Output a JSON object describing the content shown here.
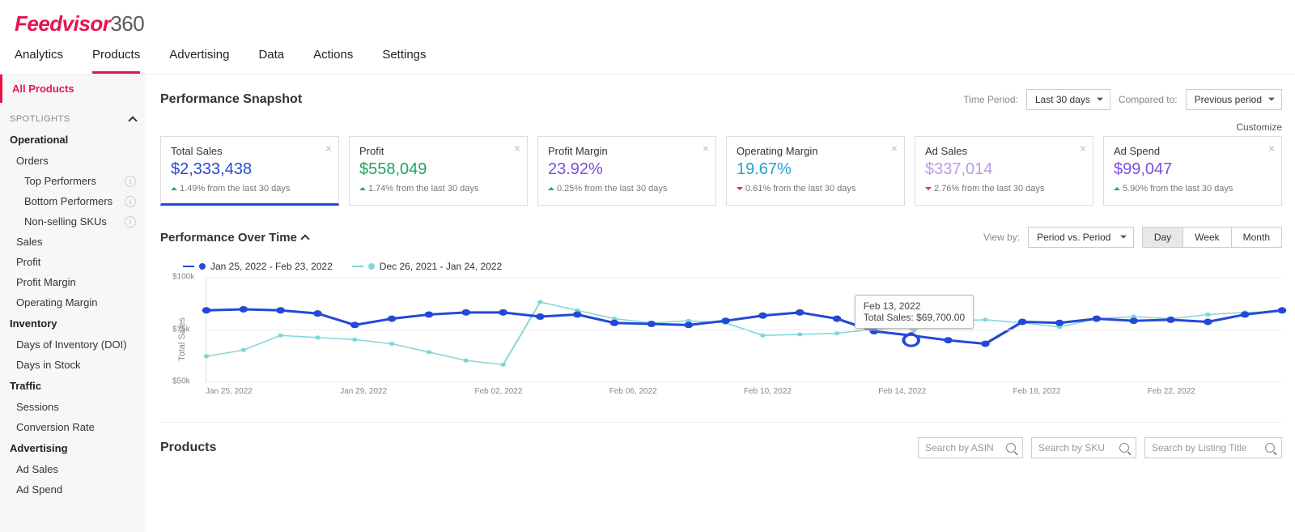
{
  "brand": {
    "name1": "Feedvisor",
    "name2": "360"
  },
  "nav": [
    "Analytics",
    "Products",
    "Advertising",
    "Data",
    "Actions",
    "Settings"
  ],
  "nav_active": 1,
  "sidebar": {
    "all_products": "All Products",
    "spotlights": "SPOTLIGHTS",
    "groups": [
      {
        "title": "Operational",
        "items": [
          {
            "label": "Orders"
          },
          {
            "label": "Top Performers",
            "info": true,
            "sub": true
          },
          {
            "label": "Bottom Performers",
            "info": true,
            "sub": true
          },
          {
            "label": "Non-selling SKUs",
            "info": true,
            "sub": true
          }
        ]
      },
      {
        "title": "",
        "items": [
          {
            "label": "Sales"
          },
          {
            "label": "Profit"
          },
          {
            "label": "Profit Margin"
          },
          {
            "label": "Operating Margin"
          }
        ]
      },
      {
        "title": "Inventory",
        "items": [
          {
            "label": "Days of Inventory (DOI)"
          },
          {
            "label": "Days in Stock"
          }
        ]
      },
      {
        "title": "Traffic",
        "items": [
          {
            "label": "Sessions"
          },
          {
            "label": "Conversion Rate"
          }
        ]
      },
      {
        "title": "Advertising",
        "items": [
          {
            "label": "Ad Sales"
          },
          {
            "label": "Ad Spend"
          }
        ]
      }
    ]
  },
  "snapshot": {
    "title": "Performance Snapshot",
    "time_period_label": "Time Period:",
    "time_period_value": "Last 30 days",
    "compared_label": "Compared to:",
    "compared_value": "Previous period",
    "customize": "Customize"
  },
  "cards": [
    {
      "title": "Total Sales",
      "value": "$2,333,438",
      "color": "#2449d6",
      "dir": "up",
      "delta": "1.49% from the last 30 days",
      "selected": true
    },
    {
      "title": "Profit",
      "value": "$558,049",
      "color": "#1fa463",
      "dir": "up",
      "delta": "1.74% from the last 30 days"
    },
    {
      "title": "Profit Margin",
      "value": "23.92%",
      "color": "#7b4fe0",
      "dir": "up",
      "delta": "0.25% from the last 30 days"
    },
    {
      "title": "Operating Margin",
      "value": "19.67%",
      "color": "#1ca6c9",
      "dir": "down",
      "delta": "0.61% from the last 30 days"
    },
    {
      "title": "Ad Sales",
      "value": "$337,014",
      "color": "#b79be8",
      "dir": "down",
      "delta": "2.76% from the last 30 days"
    },
    {
      "title": "Ad Spend",
      "value": "$99,047",
      "color": "#7b4fe0",
      "dir": "up",
      "delta": "5.90% from the last 30 days"
    }
  ],
  "pot": {
    "title": "Performance Over Time",
    "view_by": "View by:",
    "period_vs": "Period vs. Period",
    "seg": [
      "Day",
      "Week",
      "Month"
    ],
    "seg_active": 0,
    "legend": [
      {
        "label": "Jan 25, 2022 - Feb 23, 2022",
        "color": "#2449d6"
      },
      {
        "label": "Dec 26, 2021 - Jan 24, 2022",
        "color": "#7fd6d6"
      }
    ],
    "ylabel": "Total Sales"
  },
  "tooltip": {
    "date": "Feb 13, 2022",
    "metric": "Total Sales: $69,700.00"
  },
  "products": {
    "title": "Products",
    "searches": [
      "Search by ASIN",
      "Search by SKU",
      "Search by Listing Title"
    ]
  },
  "chart_data": {
    "type": "line",
    "ylabel": "Total Sales",
    "ylim": [
      50000,
      100000
    ],
    "yticks": [
      50000,
      75000,
      100000
    ],
    "ytick_labels": [
      "$50k",
      "$75k",
      "$100k"
    ],
    "x_dates": [
      "Jan 25, 2022",
      "Jan 26, 2022",
      "Jan 27, 2022",
      "Jan 28, 2022",
      "Jan 29, 2022",
      "Jan 30, 2022",
      "Jan 31, 2022",
      "Feb 01, 2022",
      "Feb 02, 2022",
      "Feb 03, 2022",
      "Feb 04, 2022",
      "Feb 05, 2022",
      "Feb 06, 2022",
      "Feb 07, 2022",
      "Feb 08, 2022",
      "Feb 09, 2022",
      "Feb 10, 2022",
      "Feb 11, 2022",
      "Feb 12, 2022",
      "Feb 13, 2022",
      "Feb 14, 2022",
      "Feb 15, 2022",
      "Feb 16, 2022",
      "Feb 17, 2022",
      "Feb 18, 2022",
      "Feb 19, 2022",
      "Feb 20, 2022",
      "Feb 21, 2022",
      "Feb 22, 2022",
      "Feb 23, 2022"
    ],
    "x_tick_labels": [
      "Jan 25, 2022",
      "Jan 29, 2022",
      "Feb 02, 2022",
      "Feb 06, 2022",
      "Feb 10, 2022",
      "Feb 14, 2022",
      "Feb 18, 2022",
      "Feb 22, 2022"
    ],
    "series": [
      {
        "name": "Jan 25, 2022 - Feb 23, 2022",
        "color": "#2449d6",
        "values": [
          84000,
          84500,
          84000,
          82500,
          77000,
          80000,
          82000,
          83000,
          83000,
          81000,
          82000,
          78000,
          77500,
          77000,
          79000,
          81500,
          83000,
          80000,
          74000,
          72000,
          69700,
          68000,
          78500,
          78000,
          80000,
          79000,
          79500,
          78500,
          82000,
          84000
        ]
      },
      {
        "name": "Dec 26, 2021 - Jan 24, 2022",
        "color": "#7fd6d6",
        "values": [
          62000,
          65000,
          72000,
          71000,
          70000,
          68000,
          64000,
          60000,
          58000,
          88000,
          84000,
          80000,
          78000,
          79000,
          78000,
          72000,
          72500,
          73000,
          75000,
          76000,
          79000,
          79500,
          78000,
          76000,
          80000,
          81000,
          80000,
          82000,
          83000,
          83500
        ]
      }
    ],
    "highlight": {
      "series": 0,
      "index": 19,
      "date": "Feb 13, 2022",
      "value": 69700
    }
  }
}
